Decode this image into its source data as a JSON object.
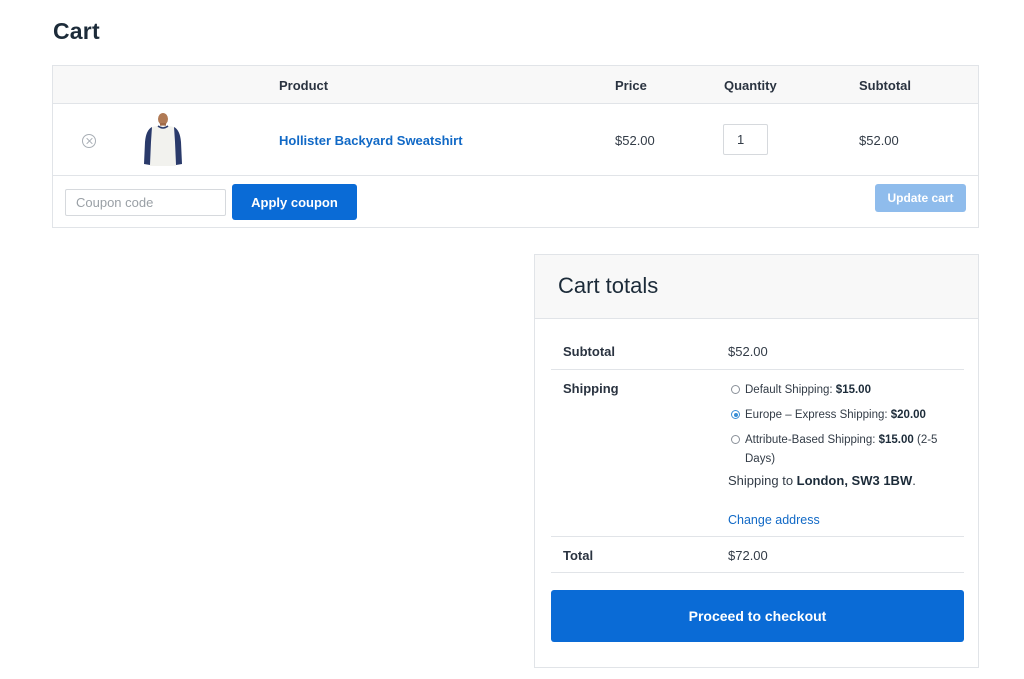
{
  "page": {
    "title": "Cart"
  },
  "cart_table": {
    "headers": {
      "product": "Product",
      "price": "Price",
      "quantity": "Quantity",
      "subtotal": "Subtotal"
    },
    "rows": [
      {
        "product": "Hollister Backyard Sweatshirt",
        "price": "$52.00",
        "quantity": "1",
        "subtotal": "$52.00",
        "thumbnail_icon": "sweatshirt-image",
        "remove_icon": "remove-circle-x-icon"
      }
    ],
    "coupon": {
      "placeholder": "Coupon code",
      "apply_label": "Apply coupon"
    },
    "update_label": "Update cart"
  },
  "totals": {
    "title": "Cart totals",
    "subtotal_label": "Subtotal",
    "subtotal_value": "$52.00",
    "shipping_label": "Shipping",
    "shipping_options": [
      {
        "label": "Default Shipping: ",
        "price": "$15.00",
        "suffix": "",
        "selected": false
      },
      {
        "label": "Europe – Express Shipping: ",
        "price": "$20.00",
        "suffix": "",
        "selected": true
      },
      {
        "label": "Attribute-Based Shipping: ",
        "price": "$15.00",
        "suffix": " (2-5 Days)",
        "selected": false
      }
    ],
    "ship_to_prefix": "Shipping to ",
    "ship_to_location": "London, SW3 1BW",
    "ship_to_suffix": ".",
    "change_address_label": "Change address",
    "total_label": "Total",
    "total_value": "$72.00",
    "checkout_label": "Proceed to checkout"
  },
  "colors": {
    "accent": "#0a6bd6",
    "link": "#1169c6",
    "update_disabled": "#8fbcec",
    "header_bg": "#f8f8f8",
    "border": "#e1e4e8"
  }
}
